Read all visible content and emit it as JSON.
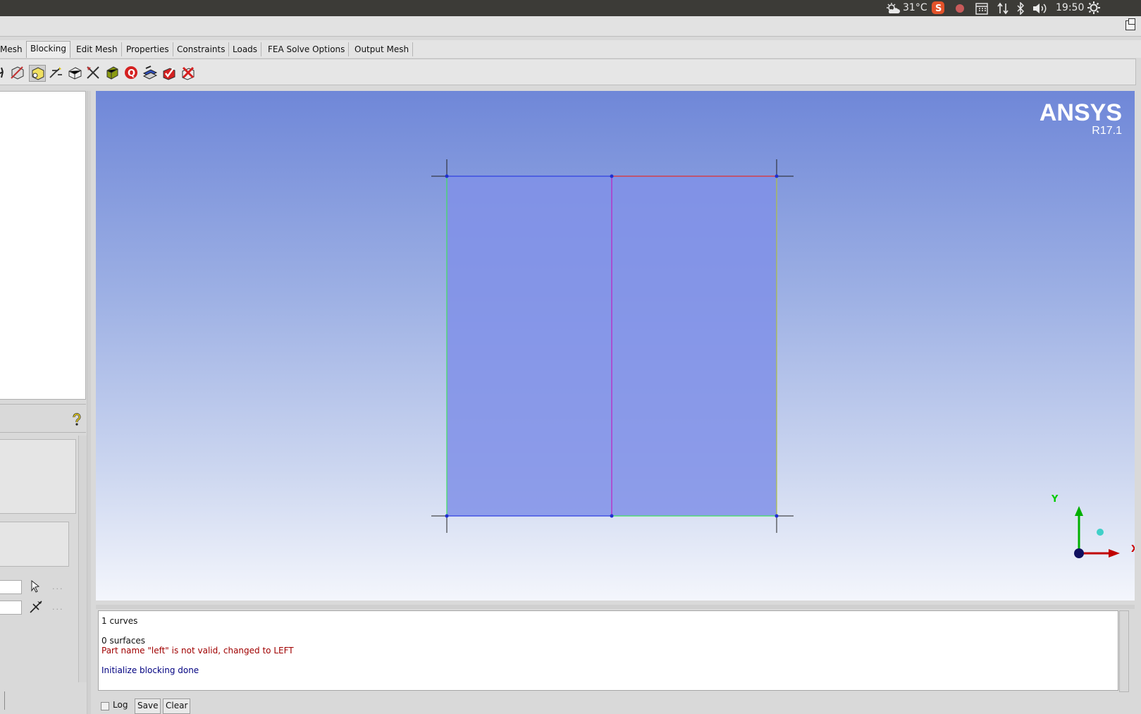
{
  "system_bar": {
    "weather": "31°C",
    "time": "19:50",
    "icons": [
      "weather-sun-cloud-icon",
      "sogou-input-icon",
      "record-icon",
      "calendar-icon",
      "network-arrows-icon",
      "bluetooth-icon",
      "volume-icon",
      "settings-gear-icon"
    ]
  },
  "tabs": [
    {
      "label": "Mesh",
      "active": false
    },
    {
      "label": "Blocking",
      "active": true
    },
    {
      "label": "Edit Mesh",
      "active": false
    },
    {
      "label": "Properties",
      "active": false
    },
    {
      "label": "Constraints",
      "active": false
    },
    {
      "label": "Loads",
      "active": false
    },
    {
      "label": "FEA Solve Options",
      "active": false
    },
    {
      "label": "Output Mesh",
      "active": false
    }
  ],
  "toolbar": {
    "tools": [
      "create-block-icon",
      "split-block-icon",
      "merge-vertices-icon",
      "edit-block-icon",
      "associate-icon",
      "move-vertex-icon",
      "transform-blocks-icon",
      "edit-edge-icon",
      "pre-mesh-params-icon",
      "pre-mesh-quality-icon",
      "pre-mesh-smooth-icon",
      "check-blocks-icon",
      "delete-block-icon"
    ]
  },
  "viewport": {
    "logo_main": "ANSYS",
    "logo_version": "R17.1",
    "axis_y": "Y",
    "axis_x": "X",
    "colors": {
      "block_fill": "#8090e8",
      "edge_blue": "#3040e0",
      "edge_red": "#e03030",
      "edge_green": "#40e060",
      "edge_purple": "#c020c0"
    }
  },
  "messages": [
    {
      "text": "1 curves",
      "color": "#111111"
    },
    {
      "text": "0 surfaces",
      "color": "#111111"
    },
    {
      "text": "Part name \"left\" is not valid, changed to LEFT",
      "color": "#a00000"
    },
    {
      "text": "Initialize blocking done",
      "color": "#000080"
    }
  ],
  "message_bar": {
    "log_label": "Log",
    "save_label": "Save",
    "clear_label": "Clear"
  }
}
